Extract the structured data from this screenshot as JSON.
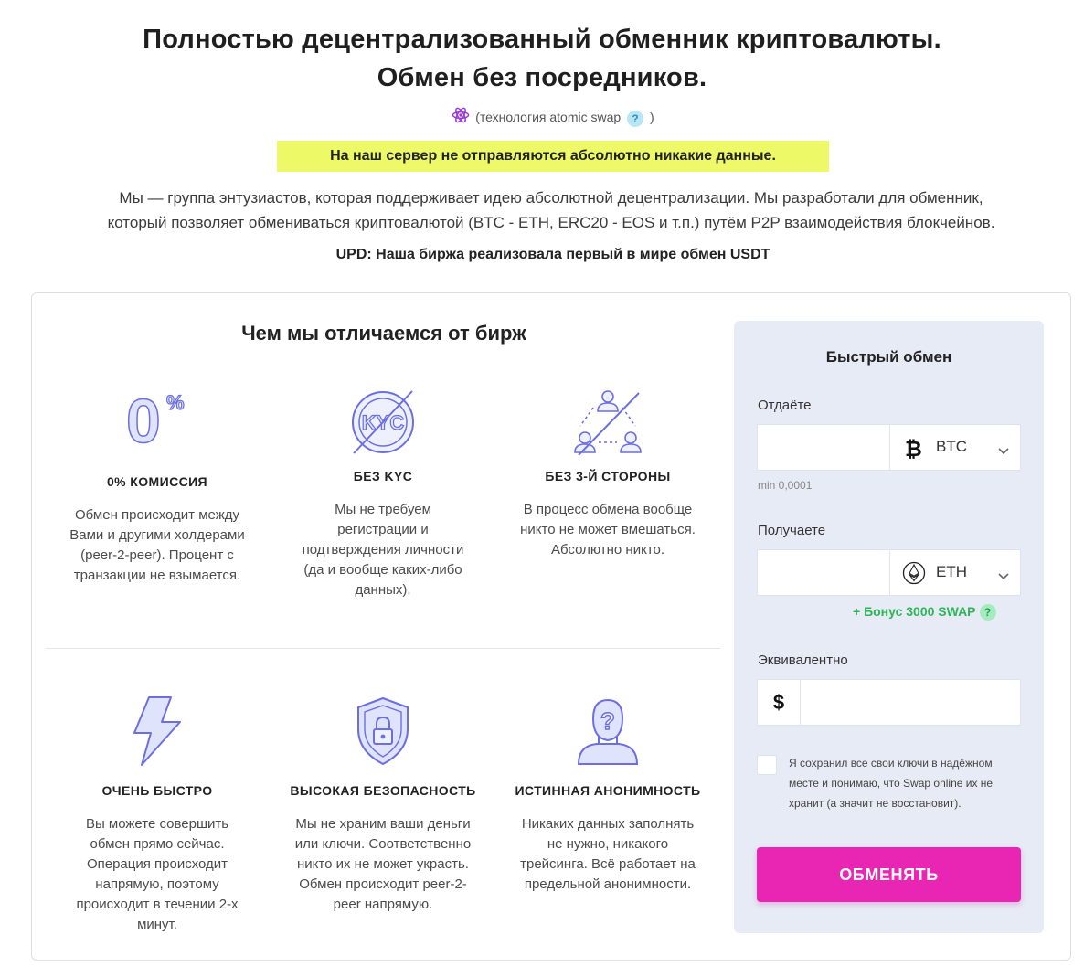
{
  "header": {
    "title_line1": "Полностью децентрализованный обменник криптовалюты.",
    "title_line2": "Обмен без посредников.",
    "tech_prefix": "(технология atomic swap",
    "tech_suffix": ")",
    "tech_help": "?",
    "notice": "На наш сервер не отправляются абсолютно никакие данные.",
    "intro_line1": "Мы — группа энтузиастов, которая поддерживает идею абсолютной децентрализации. Мы разработали для обменник,",
    "intro_line2": "который позволяет обмениваться криптовалютой (BTC - ETH, ERC20 - EOS и т.п.) путём P2P взаимодействия блокчейнов.",
    "upd": "UPD: Наша биржа реализовала первый в мире обмен USDT"
  },
  "features": {
    "title": "Чем мы отличаемся от бирж",
    "items": [
      {
        "icon": "zero-percent-icon",
        "name": "0% КОМИССИЯ",
        "desc": [
          "Обмен происходит между",
          "Вами и другими холдерами",
          "(peer-2-peer). Процент с",
          "транзакции не взымается."
        ]
      },
      {
        "icon": "no-kyc-icon",
        "name": "БЕЗ KYC",
        "desc": [
          "Мы не требуем",
          "регистрации и",
          "подтверждения личности",
          "(да и вообще каких-либо",
          "данных)."
        ]
      },
      {
        "icon": "no-third-party-icon",
        "name": "БЕЗ 3-Й СТОРОНЫ",
        "desc": [
          "В процесс обмена вообще",
          "никто не может вмешаться.",
          "Абсолютно никто."
        ]
      },
      {
        "icon": "lightning-icon",
        "name": "ОЧЕНЬ БЫСТРО",
        "desc": [
          "Вы можете совершить",
          "обмен прямо сейчас.",
          "Операция происходит",
          "напрямую, поэтому",
          "происходит в течении 2-х",
          "минут."
        ]
      },
      {
        "icon": "shield-lock-icon",
        "name": "ВЫСОКАЯ БЕЗОПАСНОСТЬ",
        "desc": [
          "Мы не храним ваши деньги",
          "или ключи. Соответственно",
          "никто их не может украсть.",
          "Обмен происходит peer-2-",
          "peer напрямую."
        ]
      },
      {
        "icon": "anonymous-user-icon",
        "name": "ИСТИННАЯ АНОНИМНОСТЬ",
        "desc": [
          "Никаких данных заполнять",
          "не нужно, никакого",
          "трейсинга. Всё работает на",
          "предельной анонимности."
        ]
      }
    ]
  },
  "exchange": {
    "title": "Быстрый обмен",
    "give_label": "Отдаёте",
    "give_value": "",
    "give_coin": "BTC",
    "give_min": "min 0,0001",
    "get_label": "Получаете",
    "get_value": "",
    "get_coin": "ETH",
    "bonus": "+ Бонус 3000 SWAP",
    "bonus_help": "?",
    "equiv_label": "Эквивалентно",
    "equiv_currency": "$",
    "equiv_value": "",
    "terms_line1": "Я сохранил все свои ключи в надёжном",
    "terms_line2": "месте и понимаю, что Swap online их не",
    "terms_line3": "хранит (а значит не восстановит).",
    "terms_checked": false,
    "submit": "ОБМЕНЯТЬ"
  },
  "colors": {
    "accent_pink": "#e926b4",
    "notice_yellow": "#eef967",
    "panel_bg": "#e6ebf5",
    "icon_purple": "#6b6fe0",
    "bonus_green": "#2fb45a"
  }
}
